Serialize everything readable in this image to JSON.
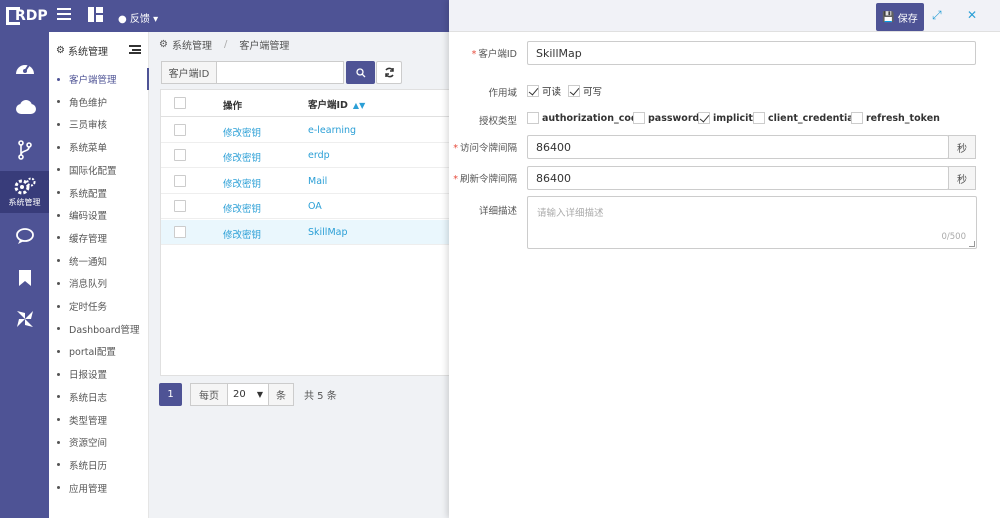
{
  "app": {
    "logo_text": "RDP",
    "feedback_label": "反馈"
  },
  "leftnav": {
    "items": [
      {
        "icon": "dashboard-icon"
      },
      {
        "icon": "cloud-icon"
      },
      {
        "icon": "branch-icon"
      },
      {
        "icon": "gears-icon",
        "label": "系统管理",
        "active": true
      },
      {
        "icon": "chat-icon"
      },
      {
        "icon": "bookmark-icon"
      },
      {
        "icon": "pinwheel-icon"
      }
    ]
  },
  "submenu": {
    "title": "系统管理",
    "items": [
      "客户端管理",
      "角色维护",
      "三员审核",
      "系统菜单",
      "国际化配置",
      "系统配置",
      "编码设置",
      "缓存管理",
      "统一通知",
      "消息队列",
      "定时任务",
      "Dashboard管理",
      "portal配置",
      "日报设置",
      "系统日志",
      "类型管理",
      "资源空间",
      "系统日历",
      "应用管理"
    ],
    "active_index": 0
  },
  "breadcrumb": {
    "root": "系统管理",
    "current": "客户端管理"
  },
  "search": {
    "label": "客户端ID",
    "value": ""
  },
  "table": {
    "headers": {
      "op": "操作",
      "client_id": "客户端ID"
    },
    "rows": [
      {
        "op": "修改密钥",
        "client_id": "e-learning"
      },
      {
        "op": "修改密钥",
        "client_id": "erdp"
      },
      {
        "op": "修改密钥",
        "client_id": "Mail"
      },
      {
        "op": "修改密钥",
        "client_id": "OA"
      },
      {
        "op": "修改密钥",
        "client_id": "SkillMap"
      }
    ],
    "selected_index": 4
  },
  "pager": {
    "current_page": "1",
    "per_page_label": "每页",
    "per_page_value": "20",
    "unit": "条",
    "total": "共 5 条"
  },
  "panel": {
    "save_label": "保存",
    "fields": {
      "client_id": {
        "label": "客户端ID",
        "value": "SkillMap"
      },
      "scope": {
        "label": "作用域",
        "options": [
          {
            "label": "可读",
            "checked": true
          },
          {
            "label": "可写",
            "checked": true
          }
        ]
      },
      "grant_type": {
        "label": "授权类型",
        "options": [
          {
            "label": "authorization_code",
            "checked": false
          },
          {
            "label": "password",
            "checked": false
          },
          {
            "label": "implicit",
            "checked": true
          },
          {
            "label": "client_credentials",
            "checked": false
          },
          {
            "label": "refresh_token",
            "checked": false
          }
        ]
      },
      "access_token": {
        "label": "访问令牌间隔",
        "value": "86400",
        "unit": "秒"
      },
      "refresh_token": {
        "label": "刷新令牌间隔",
        "value": "86400",
        "unit": "秒"
      },
      "description": {
        "label": "详细描述",
        "placeholder": "请输入详细描述",
        "counter": "0/500"
      }
    }
  },
  "colors": {
    "primary": "#4e5395",
    "link": "#2b9fd6",
    "required": "#e74c3c"
  }
}
